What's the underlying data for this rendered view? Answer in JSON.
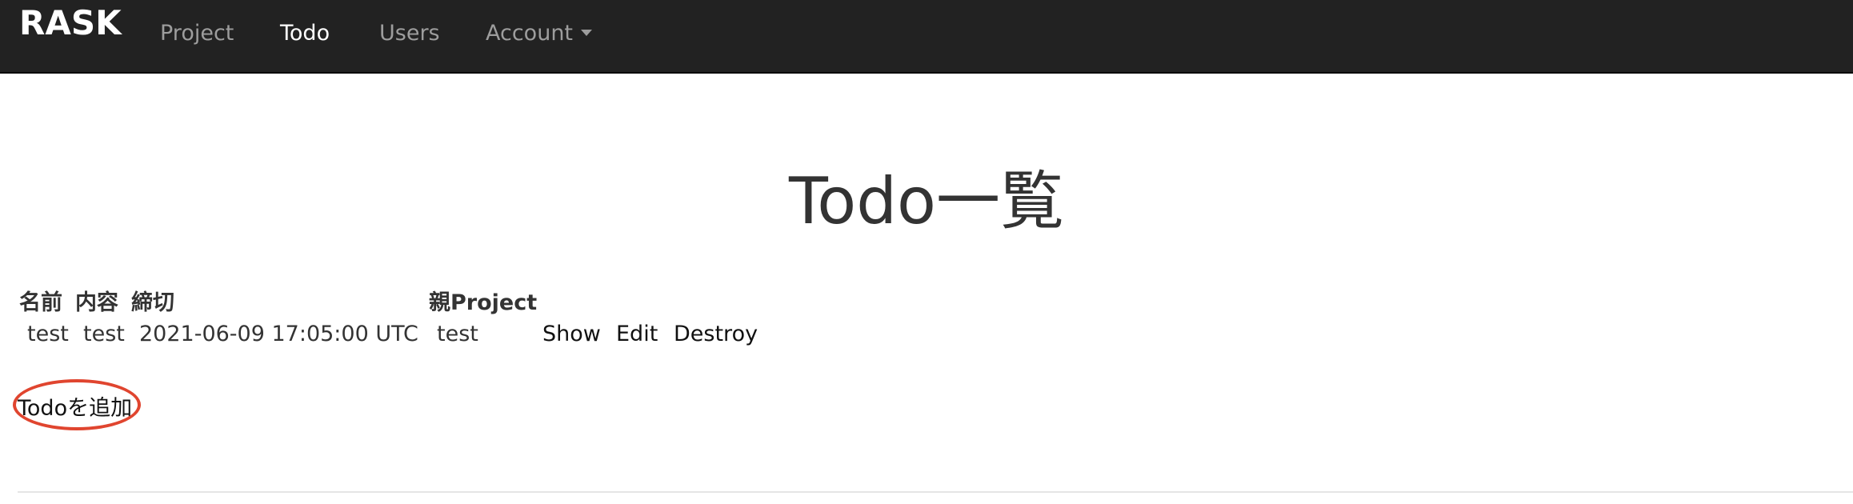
{
  "navbar": {
    "brand": "RASK",
    "items": [
      {
        "label": "Project",
        "active": false
      },
      {
        "label": "Todo",
        "active": true
      },
      {
        "label": "Users",
        "active": false
      },
      {
        "label": "Account",
        "active": false,
        "dropdown": true
      }
    ]
  },
  "main": {
    "title": "Todo一覧",
    "table": {
      "headers": [
        "名前",
        "内容",
        "締切",
        "親Project"
      ],
      "rows": [
        {
          "name": "test",
          "content": "test",
          "deadline": "2021-06-09 17:05:00 UTC",
          "project": "test",
          "actions": [
            "Show",
            "Edit",
            "Destroy"
          ]
        }
      ]
    },
    "add_link": "Todoを追加"
  },
  "colors": {
    "navbar_bg": "#222222",
    "nav_text": "#9d9d9d",
    "nav_active": "#ffffff",
    "annotation_circle": "#e0452f"
  }
}
